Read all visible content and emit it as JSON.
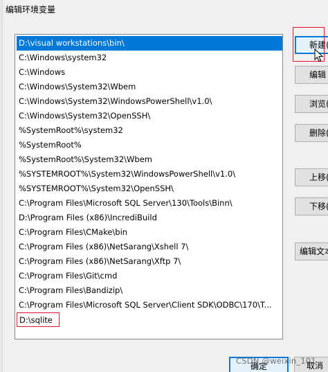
{
  "dialog": {
    "title": "编辑环境变量"
  },
  "path_list": {
    "items": [
      {
        "label": "D:\\visual workstations\\bin\\",
        "selected": true
      },
      {
        "label": "C:\\Windows\\system32"
      },
      {
        "label": "C:\\Windows"
      },
      {
        "label": "C:\\Windows\\System32\\Wbem"
      },
      {
        "label": "C:\\Windows\\System32\\WindowsPowerShell\\v1.0\\"
      },
      {
        "label": "C:\\Windows\\System32\\OpenSSH\\"
      },
      {
        "label": "%SystemRoot%\\system32"
      },
      {
        "label": "%SystemRoot%"
      },
      {
        "label": "%SystemRoot%\\System32\\Wbem"
      },
      {
        "label": "%SYSTEMROOT%\\System32\\WindowsPowerShell\\v1.0\\"
      },
      {
        "label": "%SYSTEMROOT%\\System32\\OpenSSH\\"
      },
      {
        "label": "C:\\Program Files\\Microsoft SQL Server\\130\\Tools\\Binn\\"
      },
      {
        "label": "D:\\Program Files (x86)\\IncrediBuild"
      },
      {
        "label": "C:\\Program Files\\CMake\\bin"
      },
      {
        "label": "C:\\Program Files (x86)\\NetSarang\\Xshell 7\\"
      },
      {
        "label": "C:\\Program Files (x86)\\NetSarang\\Xftp 7\\"
      },
      {
        "label": "C:\\Program Files\\Git\\cmd"
      },
      {
        "label": "C:\\Program Files\\Bandizip\\"
      },
      {
        "label": "C:\\Program Files\\Microsoft SQL Server\\Client SDK\\ODBC\\170\\T..."
      },
      {
        "label": "D:\\sqlite",
        "editing": true
      }
    ]
  },
  "buttons": {
    "new": "新建(",
    "edit": "编辑",
    "browse": "浏览(",
    "delete": "删除(",
    "move_up": "上移(",
    "move_down": "下移(",
    "edit_text": "编辑文本",
    "ok": "确定",
    "cancel": "取消"
  },
  "watermark": {
    "text": "CSDN @weixin_101"
  },
  "colors": {
    "selection": "#0078d7",
    "highlight_box": "#e81123"
  }
}
